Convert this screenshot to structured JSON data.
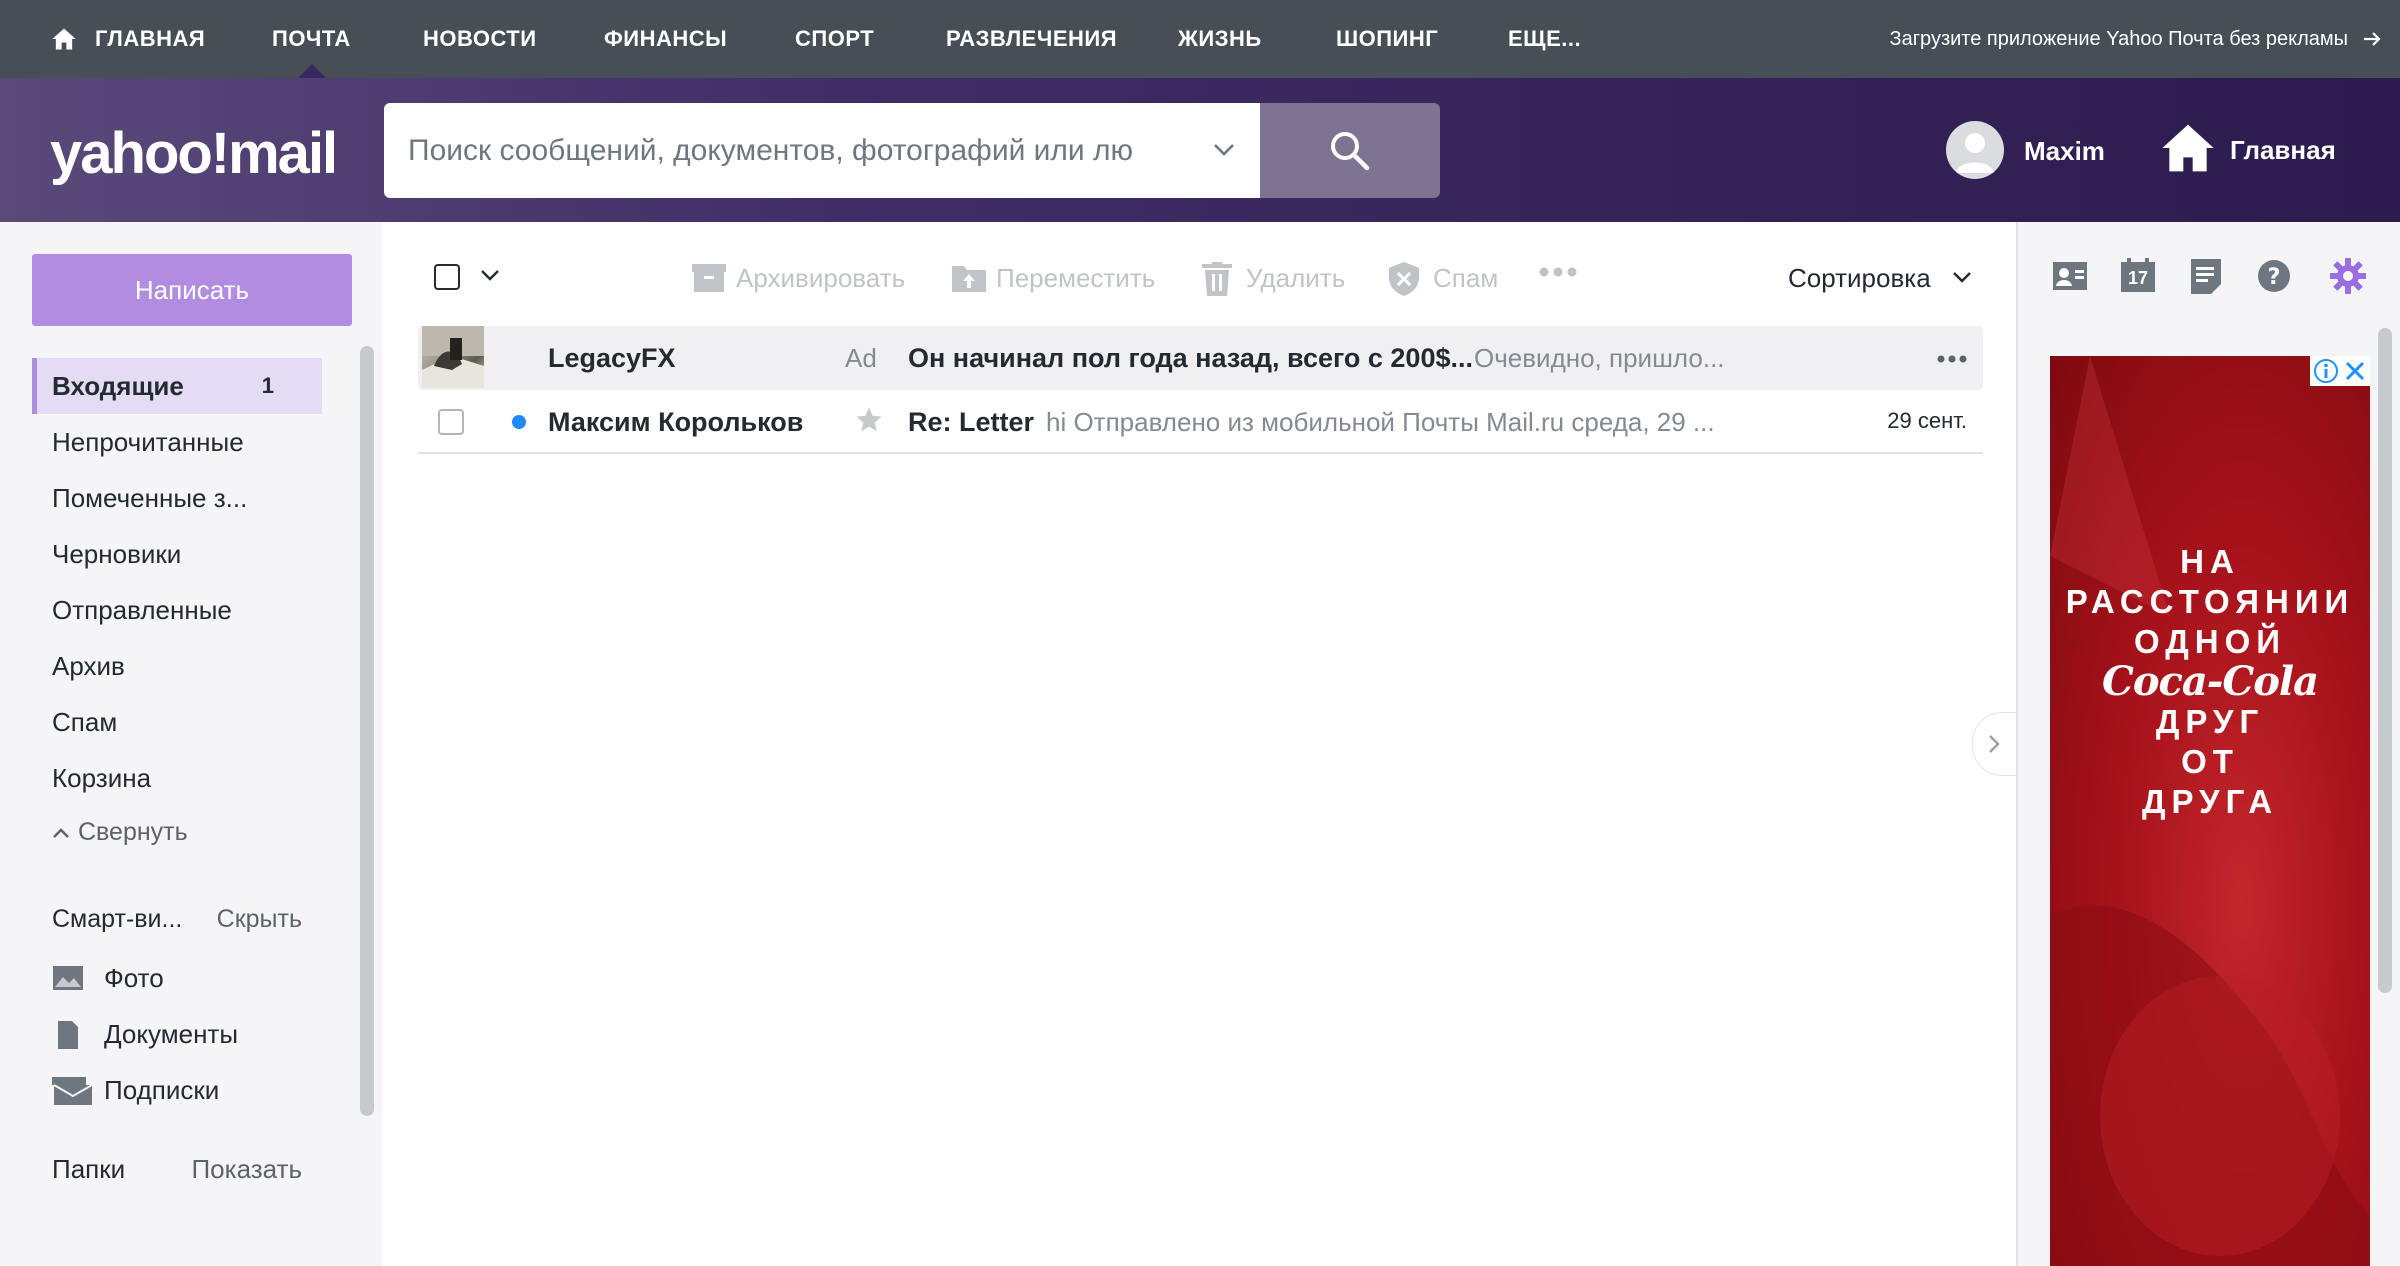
{
  "topnav": {
    "items": [
      "ГЛАВНАЯ",
      "ПОЧТА",
      "НОВОСТИ",
      "ФИНАНСЫ",
      "СПОРТ",
      "РАЗВЛЕЧЕНИЯ",
      "ЖИЗНЬ",
      "ШОПИНГ",
      "ЕЩЕ..."
    ],
    "active": "ПОЧТА",
    "promo": "Загрузите приложение Yahoo Почта без рекламы"
  },
  "header": {
    "logo": "yahoo!mail",
    "search_placeholder": "Поиск сообщений, документов, фотографий или лю",
    "user_name": "Maxim",
    "home_label": "Главная"
  },
  "sidebar": {
    "compose": "Написать",
    "folders": [
      {
        "label": "Входящие",
        "count": "1"
      },
      {
        "label": "Непрочитанные"
      },
      {
        "label": "Помеченные з..."
      },
      {
        "label": "Черновики"
      },
      {
        "label": "Отправленные"
      },
      {
        "label": "Архив"
      },
      {
        "label": "Спам"
      },
      {
        "label": "Корзина"
      }
    ],
    "collapse": "Свернуть",
    "smart_title": "Смарт-ви...",
    "smart_hide": "Скрыть",
    "smart_items": [
      "Фото",
      "Документы",
      "Подписки"
    ],
    "folders_title": "Папки",
    "folders_show": "Показать"
  },
  "toolbar": {
    "archive": "Архивировать",
    "move": "Переместить",
    "delete": "Удалить",
    "spam": "Спам",
    "sort": "Сортировка"
  },
  "messages": [
    {
      "sender": "LegacyFX",
      "tag": "Ad",
      "subject": "Он начинал пол года назад, всего с 200$...",
      "snippet": "Очевидно, пришло..."
    },
    {
      "sender": "Максим Корольков",
      "subject": "Re: Letter",
      "snippet": "hi Отправлено из мобильной Почты Mail.ru среда, 29 ...",
      "date": "29 сент."
    }
  ],
  "right_rail": {
    "calendar_day": "17",
    "ad_lines": [
      "НА",
      "РАССТОЯНИИ",
      "ОДНОЙ",
      "Coca-Cola",
      "ДРУГ",
      "ОТ",
      "ДРУГА"
    ]
  },
  "colors": {
    "topnav_bg": "#464e56",
    "header_bg": "#2c1b4d",
    "accent": "#b28ce0",
    "unread_dot": "#1d8cf8",
    "ad_red": "#c2272c"
  }
}
